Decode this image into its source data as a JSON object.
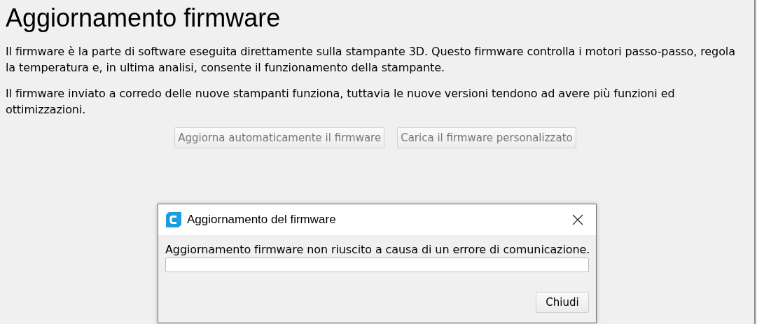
{
  "page": {
    "title": "Aggiornamento firmware",
    "paragraphs": [
      "Il firmware è la parte di software eseguita direttamente sulla stampante 3D. Questo firmware controlla i motori passo-passo, regola la temperatura e, in ultima analisi, consente il funzionamento della stampante.",
      "Il firmware inviato a corredo delle nuove stampanti funziona, tuttavia le nuove versioni tendono ad avere più funzioni ed ottimizzazioni."
    ],
    "buttons": [
      {
        "label": "Aggiorna automaticamente il firmware",
        "disabled": true
      },
      {
        "label": "Carica il firmware personalizzato",
        "disabled": true
      }
    ]
  },
  "dialog": {
    "title": "Aggiornamento del firmware",
    "message": "Aggiornamento firmware non riuscito a causa di un errore di comunicazione.",
    "progress": {
      "level": 0
    },
    "buttons": [
      {
        "label": "Chiudi"
      }
    ]
  }
}
